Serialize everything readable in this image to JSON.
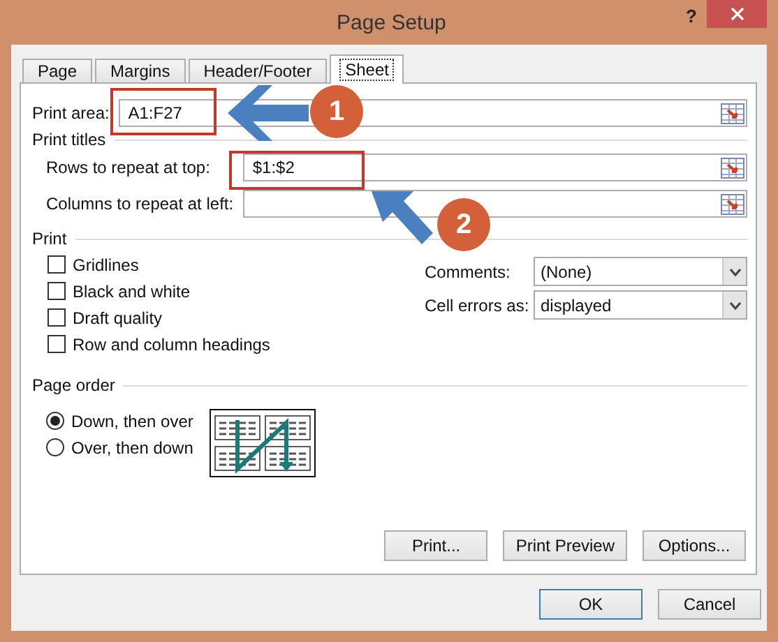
{
  "window": {
    "title": "Page Setup",
    "help": "?"
  },
  "tabs": [
    {
      "label": "Page",
      "selected": false
    },
    {
      "label": "Margins",
      "selected": false
    },
    {
      "label": "Header/Footer",
      "selected": false
    },
    {
      "label": "Sheet",
      "selected": true
    }
  ],
  "print_area": {
    "label": "Print area:",
    "value": "A1:F27"
  },
  "print_titles": {
    "heading": "Print titles",
    "rows": {
      "label": "Rows to repeat at top:",
      "value": "$1:$2"
    },
    "columns": {
      "label": "Columns to repeat at left:"
    }
  },
  "print": {
    "heading": "Print",
    "options": [
      {
        "label": "Gridlines",
        "checked": false
      },
      {
        "label": "Black and white",
        "checked": false
      },
      {
        "label": "Draft quality",
        "checked": false
      },
      {
        "label": "Row and column headings",
        "checked": false
      }
    ],
    "dropdowns": [
      {
        "label": "Comments:",
        "value": "(None)"
      },
      {
        "label": "Cell errors as:",
        "value": "displayed"
      }
    ]
  },
  "page_order": {
    "heading": "Page order",
    "options": [
      {
        "label": "Down, then over",
        "selected": true
      },
      {
        "label": "Over, then down",
        "selected": false
      }
    ]
  },
  "panel_buttons": [
    "Print...",
    "Print Preview",
    "Options..."
  ],
  "buttons": [
    {
      "label": "OK",
      "default": true
    },
    {
      "label": "Cancel",
      "default": false
    }
  ],
  "callouts": [
    {
      "number": "1"
    },
    {
      "number": "2"
    }
  ]
}
